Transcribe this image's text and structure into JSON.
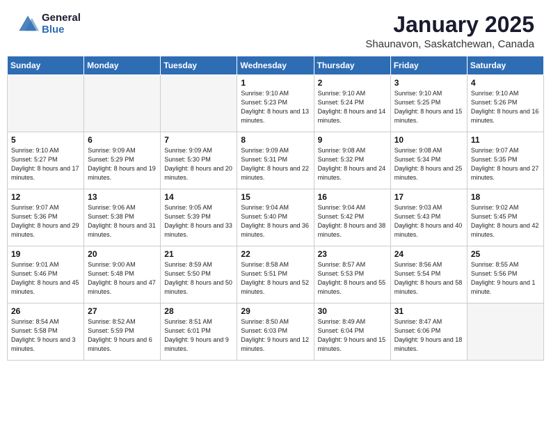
{
  "header": {
    "logo_general": "General",
    "logo_blue": "Blue",
    "month": "January 2025",
    "location": "Shaunavon, Saskatchewan, Canada"
  },
  "weekdays": [
    "Sunday",
    "Monday",
    "Tuesday",
    "Wednesday",
    "Thursday",
    "Friday",
    "Saturday"
  ],
  "weeks": [
    [
      {
        "day": "",
        "empty": true
      },
      {
        "day": "",
        "empty": true
      },
      {
        "day": "",
        "empty": true
      },
      {
        "day": "1",
        "sunrise": "9:10 AM",
        "sunset": "5:23 PM",
        "daylight": "8 hours and 13 minutes."
      },
      {
        "day": "2",
        "sunrise": "9:10 AM",
        "sunset": "5:24 PM",
        "daylight": "8 hours and 14 minutes."
      },
      {
        "day": "3",
        "sunrise": "9:10 AM",
        "sunset": "5:25 PM",
        "daylight": "8 hours and 15 minutes."
      },
      {
        "day": "4",
        "sunrise": "9:10 AM",
        "sunset": "5:26 PM",
        "daylight": "8 hours and 16 minutes."
      }
    ],
    [
      {
        "day": "5",
        "sunrise": "9:10 AM",
        "sunset": "5:27 PM",
        "daylight": "8 hours and 17 minutes."
      },
      {
        "day": "6",
        "sunrise": "9:09 AM",
        "sunset": "5:29 PM",
        "daylight": "8 hours and 19 minutes."
      },
      {
        "day": "7",
        "sunrise": "9:09 AM",
        "sunset": "5:30 PM",
        "daylight": "8 hours and 20 minutes."
      },
      {
        "day": "8",
        "sunrise": "9:09 AM",
        "sunset": "5:31 PM",
        "daylight": "8 hours and 22 minutes."
      },
      {
        "day": "9",
        "sunrise": "9:08 AM",
        "sunset": "5:32 PM",
        "daylight": "8 hours and 24 minutes."
      },
      {
        "day": "10",
        "sunrise": "9:08 AM",
        "sunset": "5:34 PM",
        "daylight": "8 hours and 25 minutes."
      },
      {
        "day": "11",
        "sunrise": "9:07 AM",
        "sunset": "5:35 PM",
        "daylight": "8 hours and 27 minutes."
      }
    ],
    [
      {
        "day": "12",
        "sunrise": "9:07 AM",
        "sunset": "5:36 PM",
        "daylight": "8 hours and 29 minutes."
      },
      {
        "day": "13",
        "sunrise": "9:06 AM",
        "sunset": "5:38 PM",
        "daylight": "8 hours and 31 minutes."
      },
      {
        "day": "14",
        "sunrise": "9:05 AM",
        "sunset": "5:39 PM",
        "daylight": "8 hours and 33 minutes."
      },
      {
        "day": "15",
        "sunrise": "9:04 AM",
        "sunset": "5:40 PM",
        "daylight": "8 hours and 36 minutes."
      },
      {
        "day": "16",
        "sunrise": "9:04 AM",
        "sunset": "5:42 PM",
        "daylight": "8 hours and 38 minutes."
      },
      {
        "day": "17",
        "sunrise": "9:03 AM",
        "sunset": "5:43 PM",
        "daylight": "8 hours and 40 minutes."
      },
      {
        "day": "18",
        "sunrise": "9:02 AM",
        "sunset": "5:45 PM",
        "daylight": "8 hours and 42 minutes."
      }
    ],
    [
      {
        "day": "19",
        "sunrise": "9:01 AM",
        "sunset": "5:46 PM",
        "daylight": "8 hours and 45 minutes."
      },
      {
        "day": "20",
        "sunrise": "9:00 AM",
        "sunset": "5:48 PM",
        "daylight": "8 hours and 47 minutes."
      },
      {
        "day": "21",
        "sunrise": "8:59 AM",
        "sunset": "5:50 PM",
        "daylight": "8 hours and 50 minutes."
      },
      {
        "day": "22",
        "sunrise": "8:58 AM",
        "sunset": "5:51 PM",
        "daylight": "8 hours and 52 minutes."
      },
      {
        "day": "23",
        "sunrise": "8:57 AM",
        "sunset": "5:53 PM",
        "daylight": "8 hours and 55 minutes."
      },
      {
        "day": "24",
        "sunrise": "8:56 AM",
        "sunset": "5:54 PM",
        "daylight": "8 hours and 58 minutes."
      },
      {
        "day": "25",
        "sunrise": "8:55 AM",
        "sunset": "5:56 PM",
        "daylight": "9 hours and 1 minute."
      }
    ],
    [
      {
        "day": "26",
        "sunrise": "8:54 AM",
        "sunset": "5:58 PM",
        "daylight": "9 hours and 3 minutes."
      },
      {
        "day": "27",
        "sunrise": "8:52 AM",
        "sunset": "5:59 PM",
        "daylight": "9 hours and 6 minutes."
      },
      {
        "day": "28",
        "sunrise": "8:51 AM",
        "sunset": "6:01 PM",
        "daylight": "9 hours and 9 minutes."
      },
      {
        "day": "29",
        "sunrise": "8:50 AM",
        "sunset": "6:03 PM",
        "daylight": "9 hours and 12 minutes."
      },
      {
        "day": "30",
        "sunrise": "8:49 AM",
        "sunset": "6:04 PM",
        "daylight": "9 hours and 15 minutes."
      },
      {
        "day": "31",
        "sunrise": "8:47 AM",
        "sunset": "6:06 PM",
        "daylight": "9 hours and 18 minutes."
      },
      {
        "day": "",
        "empty": true
      }
    ]
  ],
  "labels": {
    "sunrise_prefix": "Sunrise: ",
    "sunset_prefix": "Sunset: ",
    "daylight_prefix": "Daylight: "
  }
}
